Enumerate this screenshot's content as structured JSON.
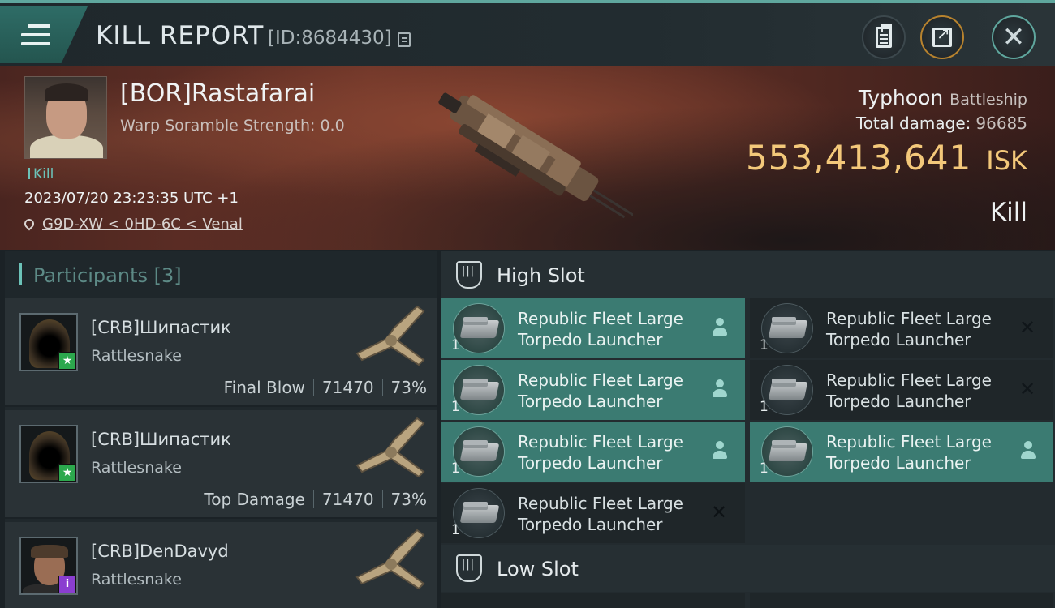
{
  "header": {
    "title": "KILL REPORT",
    "id_text": "[ID:8684430]"
  },
  "victim": {
    "name": "[BOR]Rastafarai",
    "scramble": "Warp Soramble Strength: 0.0",
    "tag": "Kill",
    "datetime": "2023/07/20 23:23:35 UTC +1",
    "location": "G9D-XW < 0HD-6C < Venal",
    "ship": "Typhoon",
    "ship_class": "Battleship",
    "total_damage_label": "Total damage:",
    "total_damage": "96685",
    "isk_value": "553,413,641",
    "isk_unit": "ISK",
    "result": "Kill"
  },
  "participants": {
    "title": "Participants [3]",
    "items": [
      {
        "name": "[CRB]Шипастик",
        "ship": "Rattlesnake",
        "role": "Final Blow",
        "damage": "71470",
        "percent": "73%",
        "badge": "★",
        "badge_color": "#2ca84d"
      },
      {
        "name": "[CRB]Шипастик",
        "ship": "Rattlesnake",
        "role": "Top Damage",
        "damage": "71470",
        "percent": "73%",
        "badge": "★",
        "badge_color": "#2ca84d"
      },
      {
        "name": "[CRB]DenDavyd",
        "ship": "Rattlesnake",
        "role": "",
        "damage": "",
        "percent": "",
        "badge": "i",
        "badge_color": "#8a3ed0"
      }
    ]
  },
  "slots": {
    "high_label": "High Slot",
    "low_label": "Low Slot",
    "modules": [
      {
        "name": "Republic Fleet Large Torpedo Launcher",
        "qty": "1",
        "state": "dropped"
      },
      {
        "name": "Republic Fleet Large Torpedo Launcher",
        "qty": "1",
        "state": "destroyed"
      },
      {
        "name": "Republic Fleet Large Torpedo Launcher",
        "qty": "1",
        "state": "dropped"
      },
      {
        "name": "Republic Fleet Large Torpedo Launcher",
        "qty": "1",
        "state": "destroyed"
      },
      {
        "name": "Republic Fleet Large Torpedo Launcher",
        "qty": "1",
        "state": "dropped"
      },
      {
        "name": "Republic Fleet Large Torpedo Launcher",
        "qty": "1",
        "state": "dropped"
      },
      {
        "name": "Republic Fleet Large Torpedo Launcher",
        "qty": "1",
        "state": "destroyed"
      }
    ]
  },
  "colors": {
    "accent": "#5fa79e",
    "isk": "#f3c87a",
    "active_module": "#3b7b72"
  }
}
